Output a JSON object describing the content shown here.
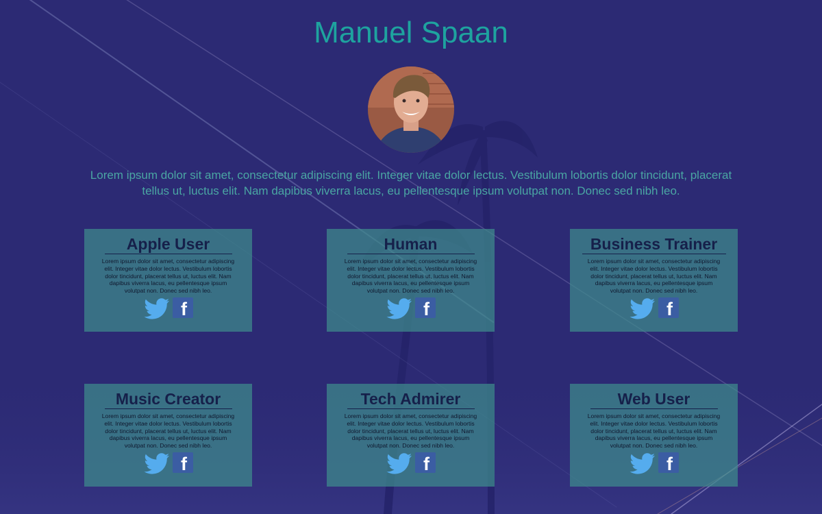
{
  "header": {
    "name": "Manuel Spaan"
  },
  "intro": "Lorem ipsum dolor sit amet, consectetur adipiscing elit. Integer vitae dolor lectus. Vestibulum lobortis dolor tincidunt, placerat tellus ut, luctus elit. Nam dapibus viverra lacus, eu pellentesque ipsum volutpat non. Donec sed nibh leo.",
  "cards": [
    {
      "title": "Apple User",
      "text": "Lorem ipsum dolor sit amet, consectetur adipiscing elit. Integer vitae dolor lectus. Vestibulum lobortis dolor tincidunt, placerat tellus ut, luctus elit. Nam dapibus viverra lacus, eu pellentesque ipsum volutpat non. Donec sed nibh leo."
    },
    {
      "title": "Human",
      "text": "Lorem ipsum dolor sit amet, consectetur adipiscing elit. Integer vitae dolor lectus. Vestibulum lobortis dolor tincidunt, placerat tellus ut, luctus elit. Nam dapibus viverra lacus, eu pellentesque ipsum volutpat non. Donec sed nibh leo."
    },
    {
      "title": "Business Trainer",
      "text": "Lorem ipsum dolor sit amet, consectetur adipiscing elit. Integer vitae dolor lectus. Vestibulum lobortis dolor tincidunt, placerat tellus ut, luctus elit. Nam dapibus viverra lacus, eu pellentesque ipsum volutpat non. Donec sed nibh leo."
    },
    {
      "title": "Music Creator",
      "text": "Lorem ipsum dolor sit amet, consectetur adipiscing elit. Integer vitae dolor lectus. Vestibulum lobortis dolor tincidunt, placerat tellus ut, luctus elit. Nam dapibus viverra lacus, eu pellentesque ipsum volutpat non. Donec sed nibh leo."
    },
    {
      "title": "Tech Admirer",
      "text": "Lorem ipsum dolor sit amet, consectetur adipiscing elit. Integer vitae dolor lectus. Vestibulum lobortis dolor tincidunt, placerat tellus ut, luctus elit. Nam dapibus viverra lacus, eu pellentesque ipsum volutpat non. Donec sed nibh leo."
    },
    {
      "title": "Web User",
      "text": "Lorem ipsum dolor sit amet, consectetur adipiscing elit. Integer vitae dolor lectus. Vestibulum lobortis dolor tincidunt, placerat tellus ut, luctus elit. Nam dapibus viverra lacus, eu pellentesque ipsum volutpat non. Donec sed nibh leo."
    }
  ],
  "social_icons": [
    "twitter-icon",
    "facebook-icon"
  ],
  "facebook_glyph": "f",
  "colors": {
    "background": "#2c2a74",
    "title": "#1ea39f",
    "intro_text": "#4aa6a3",
    "card_bg": "#3e8c8c",
    "card_title": "#16204a",
    "twitter": "#55acee",
    "facebook": "#3b5da3"
  }
}
